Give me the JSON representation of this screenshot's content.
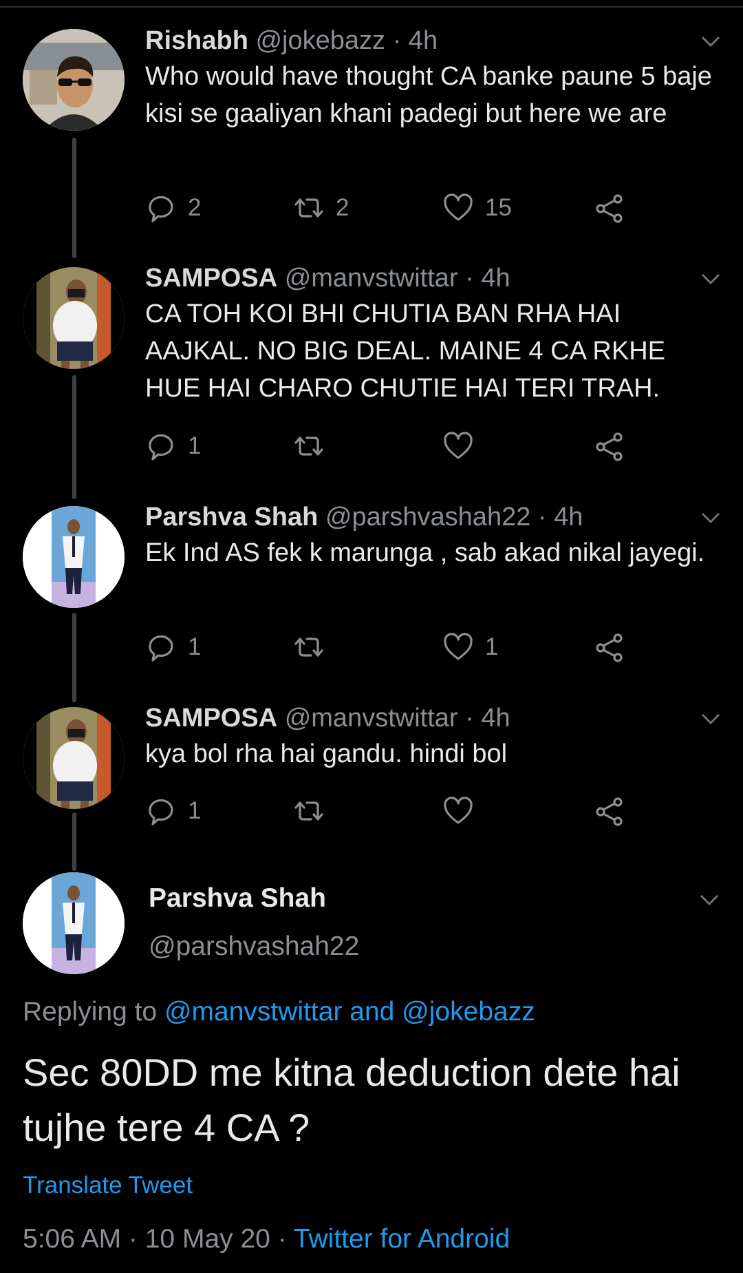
{
  "thread": [
    {
      "name": "Rishabh",
      "handle": "@jokebazz",
      "time": "· 4h",
      "text": "Who would have thought CA banke paune 5 baje kisi se gaaliyan khani padegi but here we are",
      "replies": "2",
      "retweets": "2",
      "likes": "15",
      "avatar": "rishabh-photo"
    },
    {
      "name": "SAMPOSA",
      "handle": "@manvstwittar",
      "time": "· 4h",
      "text": "CA TOH KOI BHI CHUTIA BAN RHA HAI AAJKAL. NO BIG DEAL. MAINE 4 CA RKHE HUE HAI CHARO CHUTIE HAI TERI TRAH.",
      "replies": "1",
      "retweets": "",
      "likes": "",
      "avatar": "samposa-photo"
    },
    {
      "name": "Parshva Shah",
      "handle": "@parshvashah22",
      "time": "· 4h",
      "text": "Ek Ind AS fek k marunga , sab akad nikal jayegi.",
      "replies": "1",
      "retweets": "",
      "likes": "1",
      "avatar": "parshva-photo"
    },
    {
      "name": "SAMPOSA",
      "handle": "@manvstwittar",
      "time": "· 4h",
      "text": "kya bol rha hai gandu. hindi bol",
      "replies": "1",
      "retweets": "",
      "likes": "",
      "avatar": "samposa-photo"
    }
  ],
  "main": {
    "name": "Parshva Shah",
    "handle": "@parshvashah22",
    "replying_prefix": "Replying to",
    "replying_to": "@manvstwittar and @jokebazz",
    "text": "Sec 80DD me kitna deduction dete hai tujhe tere 4 CA ?",
    "translate": "Translate Tweet",
    "timestamp": "5:06 AM · 10 May 20 ·",
    "source": "Twitter for Android"
  },
  "icons": {
    "reply": "reply-icon",
    "retweet": "retweet-icon",
    "like": "heart-icon",
    "share": "share-icon",
    "more": "chevron-down-icon"
  },
  "colors": {
    "background": "#000000",
    "link": "#1d9bf0",
    "secondary_text": "#8b8f94",
    "icon": "#8b8f94"
  }
}
